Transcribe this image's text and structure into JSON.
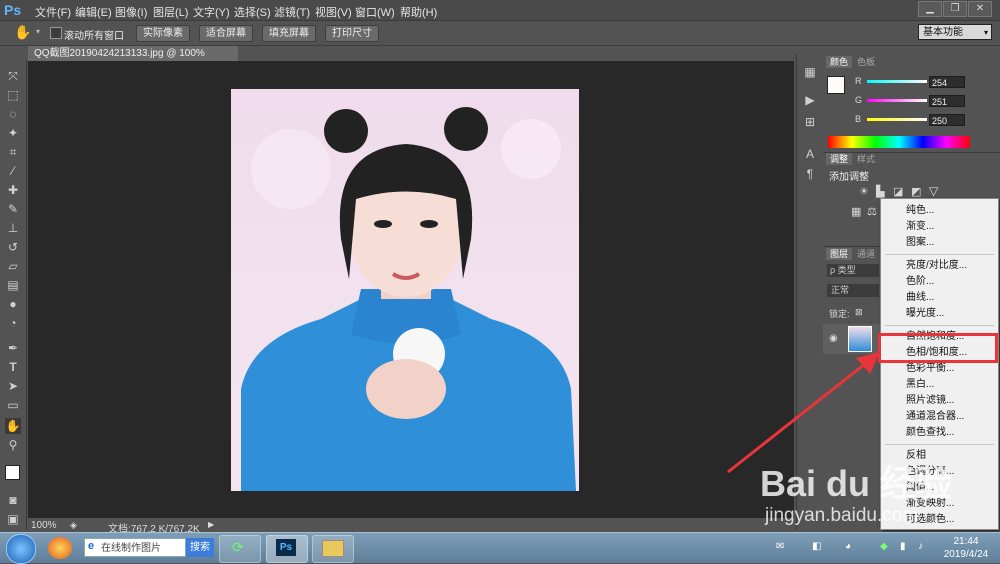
{
  "app": {
    "logo": "Ps"
  },
  "menu": [
    "文件(F)",
    "编辑(E)",
    "图像(I)",
    "图层(L)",
    "文字(Y)",
    "选择(S)",
    "滤镜(T)",
    "视图(V)",
    "窗口(W)",
    "帮助(H)"
  ],
  "options": {
    "scroll_all_windows": "滚动所有窗口",
    "actual_pixels": "实际像素",
    "fit_screen": "适合屏幕",
    "fill_screen": "填充屏幕",
    "print_size": "打印尺寸",
    "workspace": "基本功能"
  },
  "document": {
    "tab_title": "QQ截图20190424213133.jpg @ 100%(RGB/8#) *",
    "zoom": "100%",
    "doc_size": "文档:767.2 K/767.2K"
  },
  "color_panel": {
    "tab_color": "颜色",
    "tab_swatches": "色板",
    "r_label": "R",
    "r_value": "254",
    "g_label": "G",
    "g_value": "251",
    "b_label": "B",
    "b_value": "250"
  },
  "adjust_panel": {
    "tab_adjust": "调整",
    "tab_styles": "样式",
    "add_adjustment": "添加调整"
  },
  "layers_panel": {
    "tab_layers": "图层",
    "tab_channels": "通道",
    "filter_kind": "ρ 类型",
    "blend_mode": "正常",
    "lock": "锁定:"
  },
  "context_menu": {
    "group1": [
      "纯色...",
      "渐变...",
      "图案..."
    ],
    "group2": [
      "亮度/对比度...",
      "色阶...",
      "曲线...",
      "曝光度..."
    ],
    "group3": [
      "自然饱和度...",
      "色相/饱和度...",
      "色彩平衡...",
      "黑白...",
      "照片滤镜...",
      "通道混合器...",
      "颜色查找..."
    ],
    "group4": [
      "反相",
      "色调分离...",
      "阈值...",
      "渐变映射...",
      "可选颜色..."
    ]
  },
  "taskbar": {
    "search_placeholder": "在线制作图片",
    "search_button": "搜索",
    "time": "21:44",
    "date": "2019/4/24"
  },
  "watermark": {
    "brand": "Bai du 经验",
    "url": "jingyan.baidu.com"
  },
  "colors": {
    "highlight": "#e8353a",
    "ps_blue": "#5fb7ff",
    "sweater": "#2f8fd8"
  }
}
